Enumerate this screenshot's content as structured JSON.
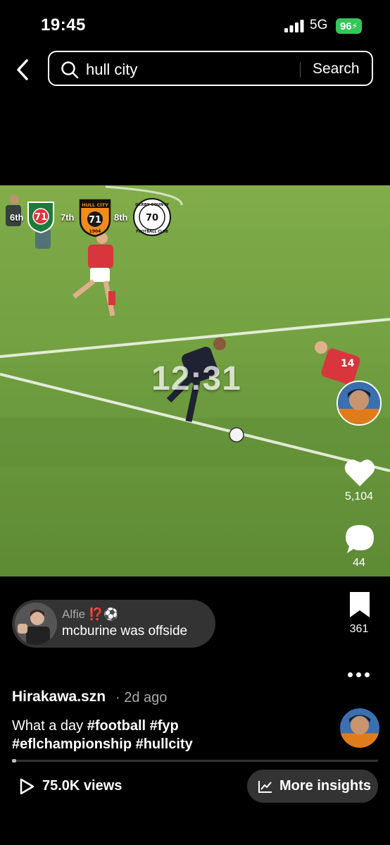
{
  "status_bar": {
    "time": "19:45",
    "network": "5G",
    "battery": "96"
  },
  "search": {
    "query": "hull city",
    "button_label": "Search"
  },
  "video": {
    "timer": "12:31",
    "standings": [
      {
        "rank": "6th",
        "points": "71"
      },
      {
        "rank": "7th",
        "points": "71"
      },
      {
        "rank": "8th",
        "points": "70"
      }
    ],
    "badge_labels": {
      "hull": "HULL CITY",
      "hull_year": "1904",
      "derby": "DERBY COUNTY",
      "derby_sub": "FOOTBALL CLUB"
    }
  },
  "actions": {
    "likes": "5,104",
    "comments": "44",
    "saves": "361"
  },
  "comment": {
    "user": "Alfie ⁉️⚽",
    "text": "mcburine was offside"
  },
  "post": {
    "author": "Hirakawa.szn",
    "age": "· 2d ago",
    "caption_text": "What a day",
    "hashtags_line1": "#football #fyp",
    "hashtags_line2": "#eflchampionship #hullcity",
    "progress": 0.01
  },
  "footer": {
    "views": "75.0K views",
    "insights_label": "More insights"
  },
  "colors": {
    "battery": "#34c759",
    "pitch": "#6b9b3c",
    "kit_red": "#d8363c",
    "hull_orange": "#f28a1c"
  }
}
